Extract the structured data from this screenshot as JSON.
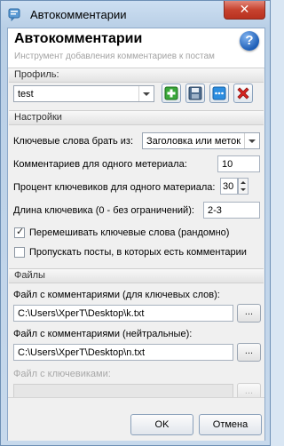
{
  "window": {
    "title": "Автокомментарии",
    "close_glyph": "✕"
  },
  "header": {
    "title": "Автокомментарии",
    "subtitle": "Инструмент добавления комментариев к постам",
    "help_glyph": "?"
  },
  "profile": {
    "section_label": "Профиль:",
    "selected": "test",
    "buttons": [
      "add-icon",
      "save-icon",
      "more-icon",
      "delete-icon"
    ]
  },
  "settings": {
    "section_label": "Настройки",
    "keywords_source_label": "Ключевые слова брать из:",
    "keywords_source_value": "Заголовка или меток",
    "comments_per_material_label": "Комментариев для одного метериала:",
    "comments_per_material_value": "10",
    "keyword_percent_label": "Процент ключевиков для одного материала:",
    "keyword_percent_value": "30",
    "keyword_length_label": "Длина ключевика (0 - без ограничений):",
    "keyword_length_value": "2-3",
    "shuffle_label": "Перемешивать ключевые слова (рандомно)",
    "shuffle_checked": true,
    "skip_label": "Пропускать посты, в которых есть комментарии",
    "skip_checked": false
  },
  "files": {
    "section_label": "Файлы",
    "keywords_file_label": "Файл с комментариями (для ключевых слов):",
    "keywords_file_value": "C:\\Users\\XperT\\Desktop\\k.txt",
    "neutral_file_label": "Файл с комментариями (нейтральные):",
    "neutral_file_value": "C:\\Users\\XperT\\Desktop\\n.txt",
    "keywords_list_label": "Файл с ключевиками:",
    "keywords_list_value": "",
    "browse_label": "..."
  },
  "footer": {
    "ok_label": "OK",
    "cancel_label": "Отмена"
  },
  "colors": {
    "accent": "#1f5fb7",
    "close": "#c7432f",
    "add": "#2e9e2e",
    "delete": "#d8231f"
  }
}
